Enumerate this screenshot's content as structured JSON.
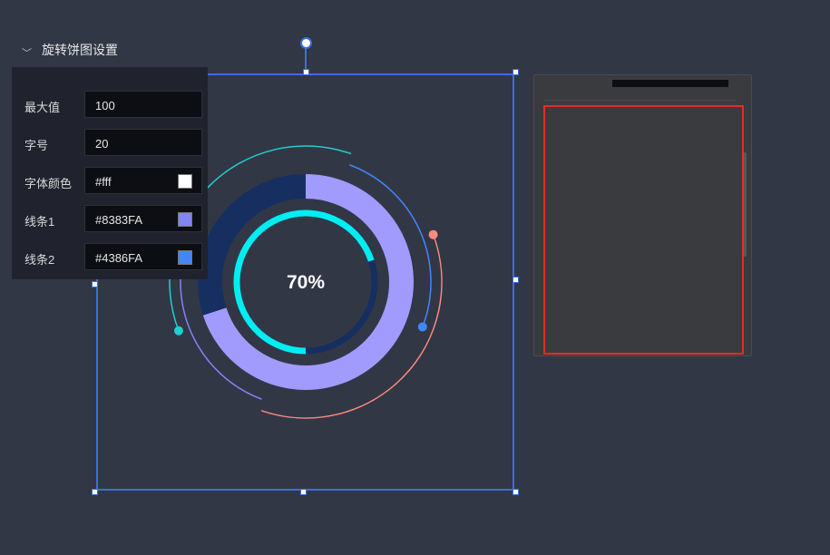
{
  "chart_data": {
    "type": "pie",
    "center_label": "70%",
    "value": 70,
    "max": 100,
    "colors": {
      "outer_fill": "#A29BFE",
      "outer_bg": "#172F60",
      "inner_fill": "#00EEF2",
      "inner_bg": "#172F60",
      "label": "#ffffff",
      "arc_cyan": "#1fcfd1",
      "arc_blue": "#4386FA",
      "arc_purple": "#8383FA",
      "arc_salmon": "#FF8A80"
    }
  },
  "panel": {
    "section_title": "旋转饼图设置",
    "fields": [
      {
        "label": "最大值",
        "value": "100"
      },
      {
        "label": "字号",
        "value": "20"
      },
      {
        "label": "字体颜色",
        "value": "#fff",
        "swatch": "#ffffff"
      },
      {
        "label": "线条1",
        "value": "#8383FA",
        "swatch": "#8383FA"
      },
      {
        "label": "线条2",
        "value": "#4386FA",
        "swatch": "#4386FA"
      }
    ]
  }
}
